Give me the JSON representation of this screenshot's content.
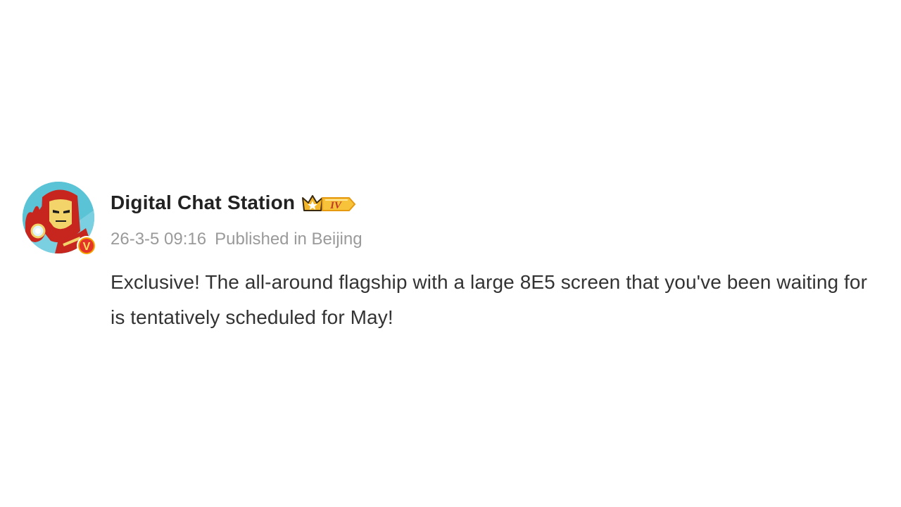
{
  "post": {
    "author": {
      "name": "Digital Chat Station",
      "level_badge": "IV",
      "verified_mark": "V",
      "avatar_icon": "iron-man-avatar"
    },
    "timestamp": "26-3-5 09:16",
    "location": "Published in Beijing",
    "text": "Exclusive! The all-around flagship with a large 8E5 screen that you've been waiting for is tentatively scheduled for May!"
  },
  "colors": {
    "username": "#222222",
    "meta": "#9a9a9a",
    "body": "#333333",
    "badge_gold": "#f5b72a",
    "verified": "#f3a300"
  }
}
